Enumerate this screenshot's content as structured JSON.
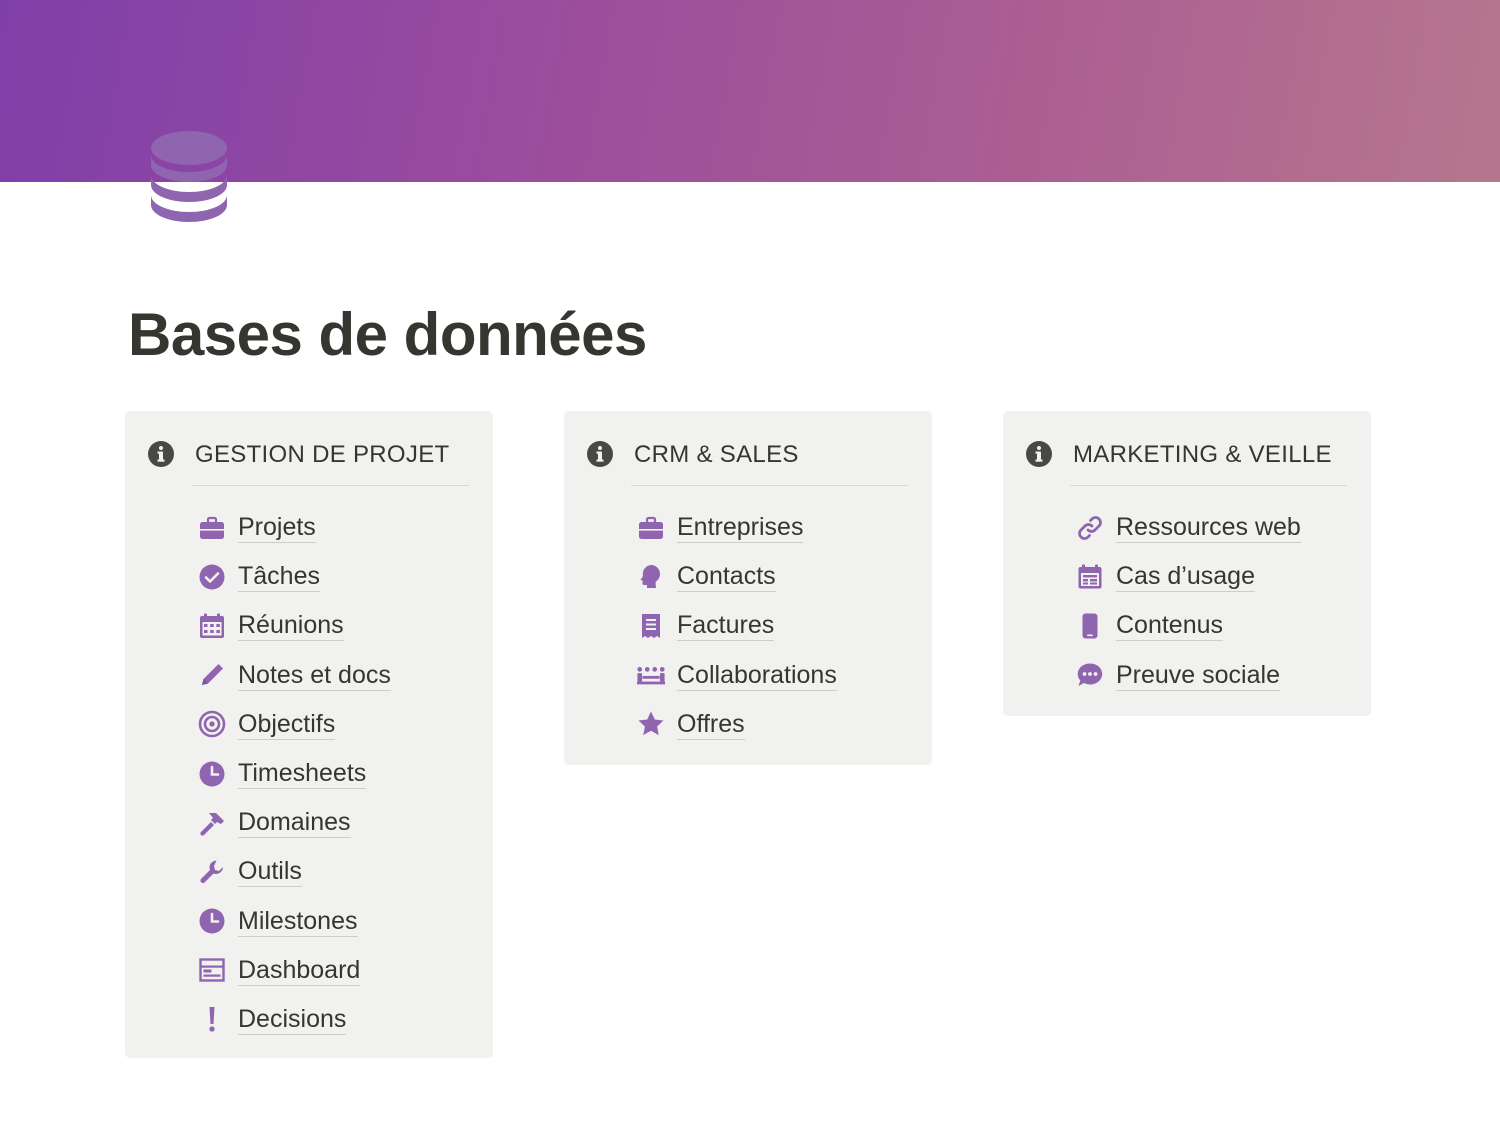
{
  "page": {
    "title": "Bases de données",
    "icon": "database-icon",
    "cover_colors": [
      "#7f3fa9",
      "#b5778e"
    ]
  },
  "colors": {
    "accent": "#9065b0",
    "text": "#37352f",
    "callout_bg": "#f1f1ef"
  },
  "callouts": [
    {
      "icon": "info-icon",
      "title": "GESTION DE PROJET",
      "links": [
        {
          "label": "Projets",
          "icon": "briefcase-icon"
        },
        {
          "label": "Tâches",
          "icon": "check-circle-icon"
        },
        {
          "label": "Réunions",
          "icon": "calendar-icon"
        },
        {
          "label": "Notes et docs",
          "icon": "pencil-icon"
        },
        {
          "label": "Objectifs",
          "icon": "target-icon"
        },
        {
          "label": "Timesheets",
          "icon": "clock-icon"
        },
        {
          "label": "Domaines",
          "icon": "hammer-icon"
        },
        {
          "label": "Outils",
          "icon": "wrench-icon"
        },
        {
          "label": "Milestones",
          "icon": "clock-icon"
        },
        {
          "label": "Dashboard",
          "icon": "dashboard-icon"
        },
        {
          "label": "Decisions",
          "icon": "exclamation-icon"
        }
      ]
    },
    {
      "icon": "info-icon",
      "title": "CRM & SALES",
      "links": [
        {
          "label": "Entreprises",
          "icon": "briefcase-icon"
        },
        {
          "label": "Contacts",
          "icon": "user-head-icon"
        },
        {
          "label": "Factures",
          "icon": "receipt-icon"
        },
        {
          "label": "Collaborations",
          "icon": "meeting-icon"
        },
        {
          "label": "Offres",
          "icon": "star-icon"
        }
      ]
    },
    {
      "icon": "info-icon",
      "title": "MARKETING & VEILLE",
      "links": [
        {
          "label": "Ressources web",
          "icon": "link-icon"
        },
        {
          "label": "Cas d’usage",
          "icon": "calendar-list-icon"
        },
        {
          "label": "Contenus",
          "icon": "phone-icon"
        },
        {
          "label": "Preuve sociale",
          "icon": "chat-bubble-icon"
        }
      ]
    }
  ]
}
